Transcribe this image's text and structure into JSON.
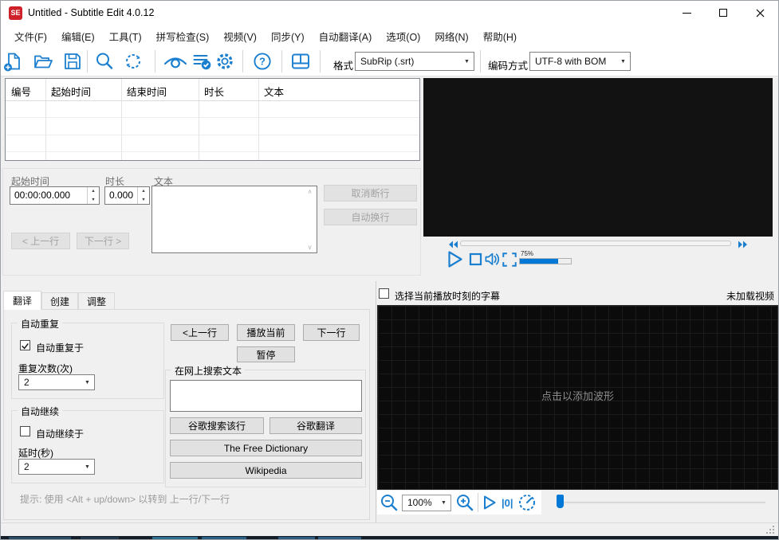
{
  "window": {
    "title": "Untitled - Subtitle Edit 4.0.12"
  },
  "menu": {
    "items": [
      "文件(F)",
      "编辑(E)",
      "工具(T)",
      "拼写检查(S)",
      "视频(V)",
      "同步(Y)",
      "自动翻译(A)",
      "选项(O)",
      "网络(N)",
      "帮助(H)"
    ]
  },
  "toolbar": {
    "format_label": "格式",
    "format_value": "SubRip (.srt)",
    "encoding_label": "编码方式",
    "encoding_value": "UTF-8 with BOM"
  },
  "table": {
    "columns": [
      "编号",
      "起始时间",
      "结束时间",
      "时长",
      "文本"
    ]
  },
  "editor": {
    "start_label": "起始时间",
    "start_value": "00:00:00.000",
    "duration_label": "时长",
    "duration_value": "0.000",
    "text_label": "文本",
    "prev": "< 上一行",
    "next": "下一行 >",
    "unbreak": "取消断行",
    "autobreak": "自动换行"
  },
  "tabs": {
    "items": [
      "翻译",
      "创建",
      "调整"
    ]
  },
  "translate": {
    "auto_repeat": {
      "title": "自动重复",
      "checkbox": "自动重复于",
      "count_label": "重复次数(次)",
      "count_value": "2"
    },
    "auto_continue": {
      "title": "自动继续",
      "checkbox": "自动继续于",
      "delay_label": "延时(秒)",
      "delay_value": "2"
    },
    "buttons": {
      "prev": "<上一行",
      "play_current": "播放当前",
      "next": "下一行",
      "pause": "暂停"
    },
    "web_search": {
      "title": "在网上搜索文本",
      "google_line": "谷歌搜索该行",
      "google_translate": "谷歌翻译",
      "free_dictionary": "The Free Dictionary",
      "wikipedia": "Wikipedia"
    },
    "hint": "提示: 使用 <Alt + up/down> 以转到 上一行/下一行"
  },
  "video": {
    "volume_label": "75%"
  },
  "waveform": {
    "select_label": "选择当前播放时刻的字幕",
    "status": "未加载视频",
    "placeholder": "点击以添加波形",
    "zoom_value": "100%",
    "play_from_zero": "|0|"
  },
  "icons": {
    "combo_arrow": "▼",
    "spin_up": "▲",
    "spin_down": "▼",
    "scroll_up": "∧",
    "scroll_down": "∨"
  },
  "colors": {
    "accent": "#1b7fd0",
    "selection_blue": "#0078d7",
    "logo_red": "#cf2129"
  }
}
